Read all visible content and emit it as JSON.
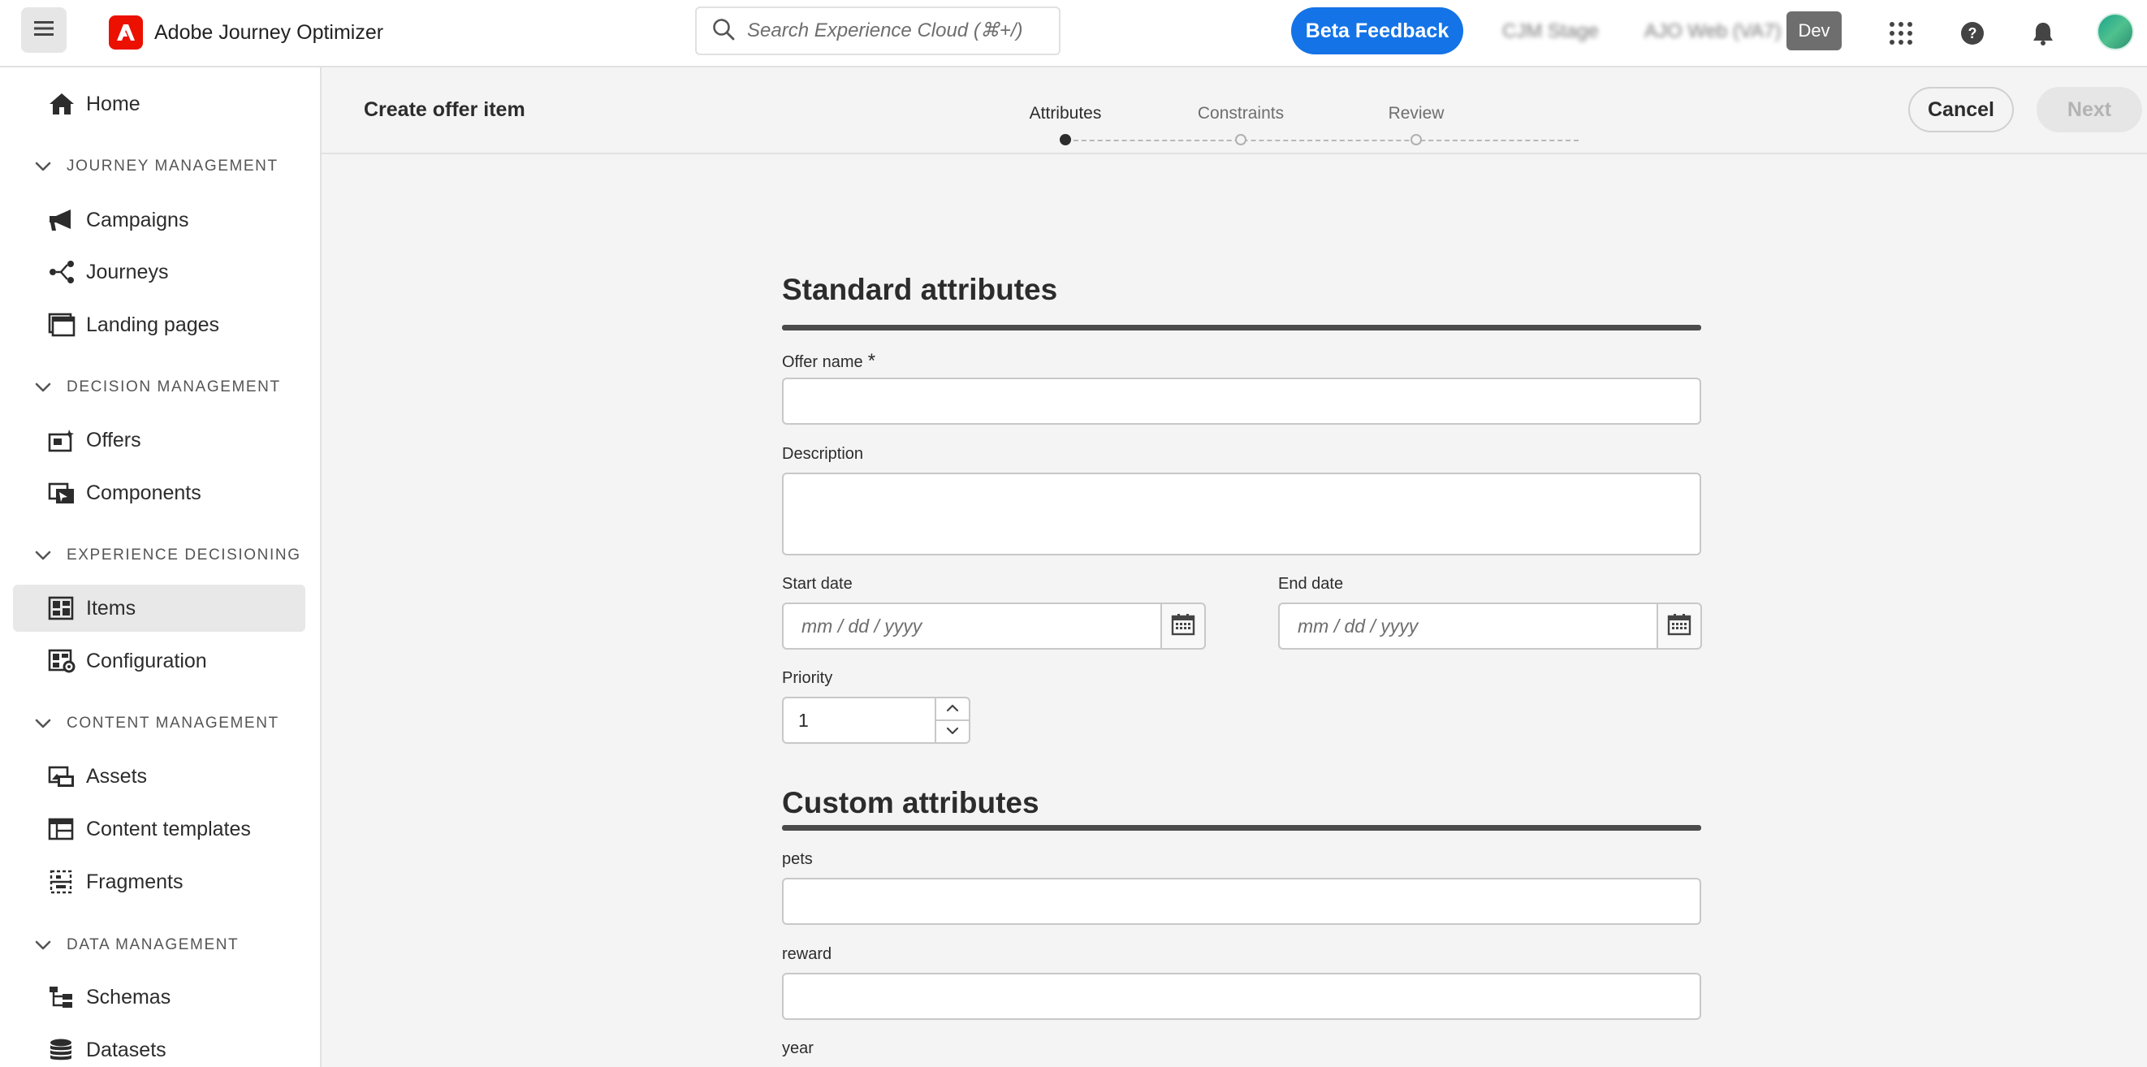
{
  "app": {
    "title": "Adobe Journey Optimizer"
  },
  "search": {
    "placeholder": "Search Experience Cloud (⌘+/)"
  },
  "header": {
    "beta_feedback": "Beta Feedback",
    "org_blurred": "CJM Stage",
    "sandbox_blurred": "AJO Web (VA7)",
    "env_badge": "Dev"
  },
  "sidebar": {
    "home": "Home",
    "sections": {
      "journey": "JOURNEY MANAGEMENT",
      "decision": "DECISION MANAGEMENT",
      "experience": "EXPERIENCE DECISIONING",
      "content": "CONTENT MANAGEMENT",
      "data": "DATA MANAGEMENT"
    },
    "items": {
      "campaigns": "Campaigns",
      "journeys": "Journeys",
      "landing_pages": "Landing pages",
      "offers": "Offers",
      "components": "Components",
      "items": "Items",
      "configuration": "Configuration",
      "assets": "Assets",
      "content_templates": "Content templates",
      "fragments": "Fragments",
      "schemas": "Schemas",
      "datasets": "Datasets"
    },
    "active_item": "Items"
  },
  "wizard": {
    "title": "Create offer item",
    "steps": [
      "Attributes",
      "Constraints",
      "Review"
    ],
    "current_step": "Attributes",
    "cancel": "Cancel",
    "next": "Next"
  },
  "form": {
    "standard_heading": "Standard attributes",
    "offer_name_label": "Offer name",
    "required_mark": "*",
    "offer_name_value": "",
    "description_label": "Description",
    "description_value": "",
    "start_date_label": "Start date",
    "end_date_label": "End date",
    "date_placeholder": "mm / dd / yyyy",
    "priority_label": "Priority",
    "priority_value": "1",
    "custom_heading": "Custom attributes",
    "pets_label": "pets",
    "reward_label": "reward",
    "year_label": "year"
  },
  "colors": {
    "brand_red": "#eb1000",
    "accent_blue": "#1473e6",
    "rule_dark": "#4b4b4b"
  },
  "icons": [
    "menu-icon",
    "adobe-logo-icon",
    "search-icon",
    "apps-grid-icon",
    "help-icon",
    "bell-icon",
    "home-icon",
    "megaphone-icon",
    "journey-icon",
    "landing-page-icon",
    "offer-icon",
    "components-icon",
    "items-icon",
    "configuration-icon",
    "assets-icon",
    "content-template-icon",
    "fragment-icon",
    "schema-icon",
    "dataset-icon",
    "chevron-down-icon",
    "calendar-icon",
    "chevron-up-icon"
  ]
}
